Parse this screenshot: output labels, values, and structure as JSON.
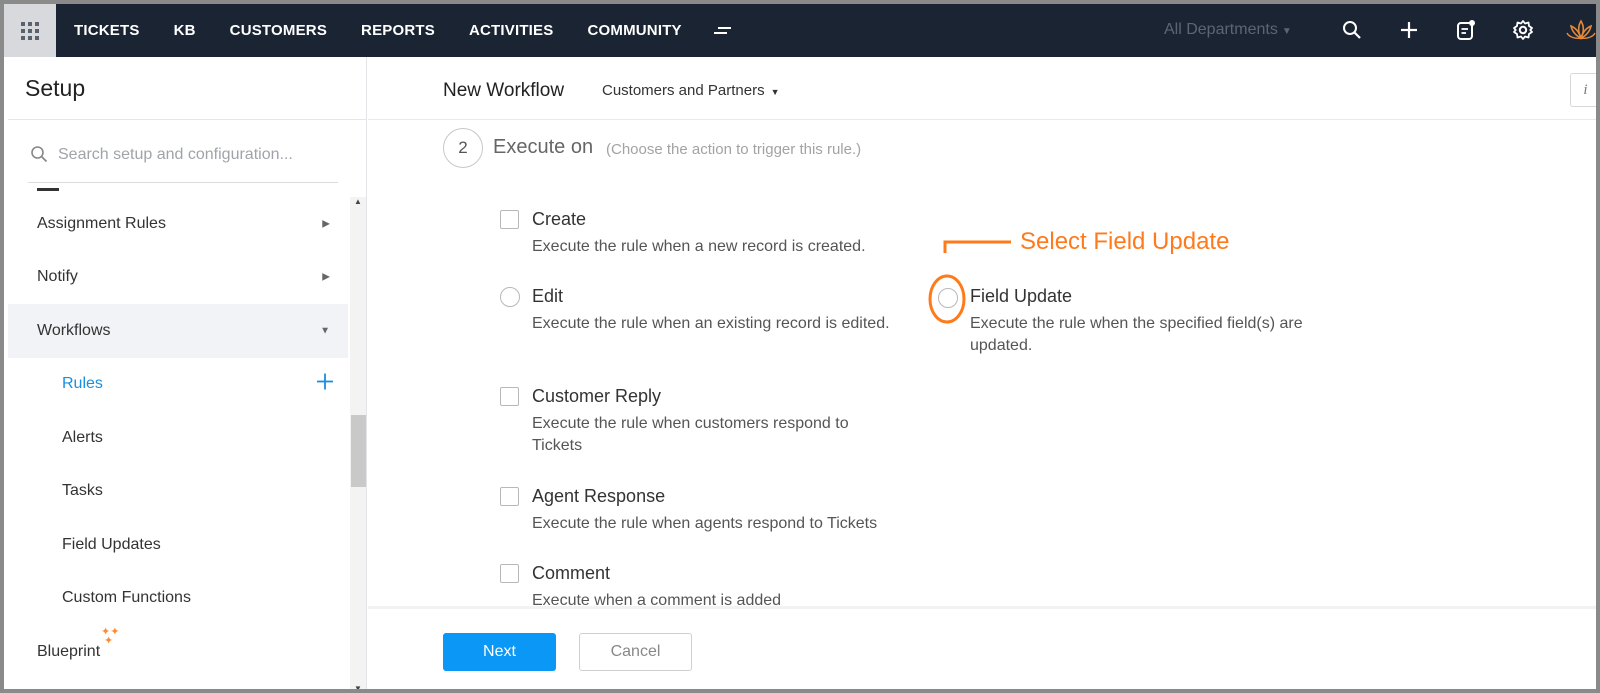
{
  "topnav": {
    "tabs": [
      "TICKETS",
      "KB",
      "CUSTOMERS",
      "REPORTS",
      "ACTIVITIES",
      "COMMUNITY"
    ],
    "more_icon": "menu-more-icon",
    "department_select": "All Departments",
    "icons": [
      "search-icon",
      "plus-icon",
      "notes-icon",
      "gear-icon",
      "logo-icon"
    ]
  },
  "setup": {
    "title": "Setup",
    "search_placeholder": "Search setup and configuration...",
    "menu": [
      {
        "label": "Assignment Rules"
      },
      {
        "label": "Notify"
      },
      {
        "label": "Workflows"
      },
      {
        "label": "Rules"
      },
      {
        "label": "Alerts"
      },
      {
        "label": "Tasks"
      },
      {
        "label": "Field Updates"
      },
      {
        "label": "Custom Functions"
      },
      {
        "label": "Blueprint"
      }
    ]
  },
  "main": {
    "title": "New Workflow",
    "department": "Customers and Partners",
    "info_label": "i",
    "step": {
      "number": "2",
      "title": "Execute on",
      "hint": "(Choose the action to trigger this rule.)"
    },
    "options": [
      {
        "label": "Create",
        "desc": "Execute the rule when a new record is created."
      },
      {
        "label": "Edit",
        "desc": "Execute the rule when an existing record is edited."
      },
      {
        "label": "Field Update",
        "desc": "Execute the rule when the specified field(s) are updated."
      },
      {
        "label": "Customer Reply",
        "desc": "Execute the rule when customers respond to Tickets"
      },
      {
        "label": "Agent Response",
        "desc": "Execute the rule when agents respond to Tickets"
      },
      {
        "label": "Comment",
        "desc": "Execute when a comment is added"
      }
    ],
    "annotation": "Select Field Update",
    "next_label": "Next",
    "cancel_label": "Cancel"
  },
  "colors": {
    "nav_bg": "#1b2433",
    "accent": "#0a97f5",
    "annotation": "#ff7a1a"
  }
}
